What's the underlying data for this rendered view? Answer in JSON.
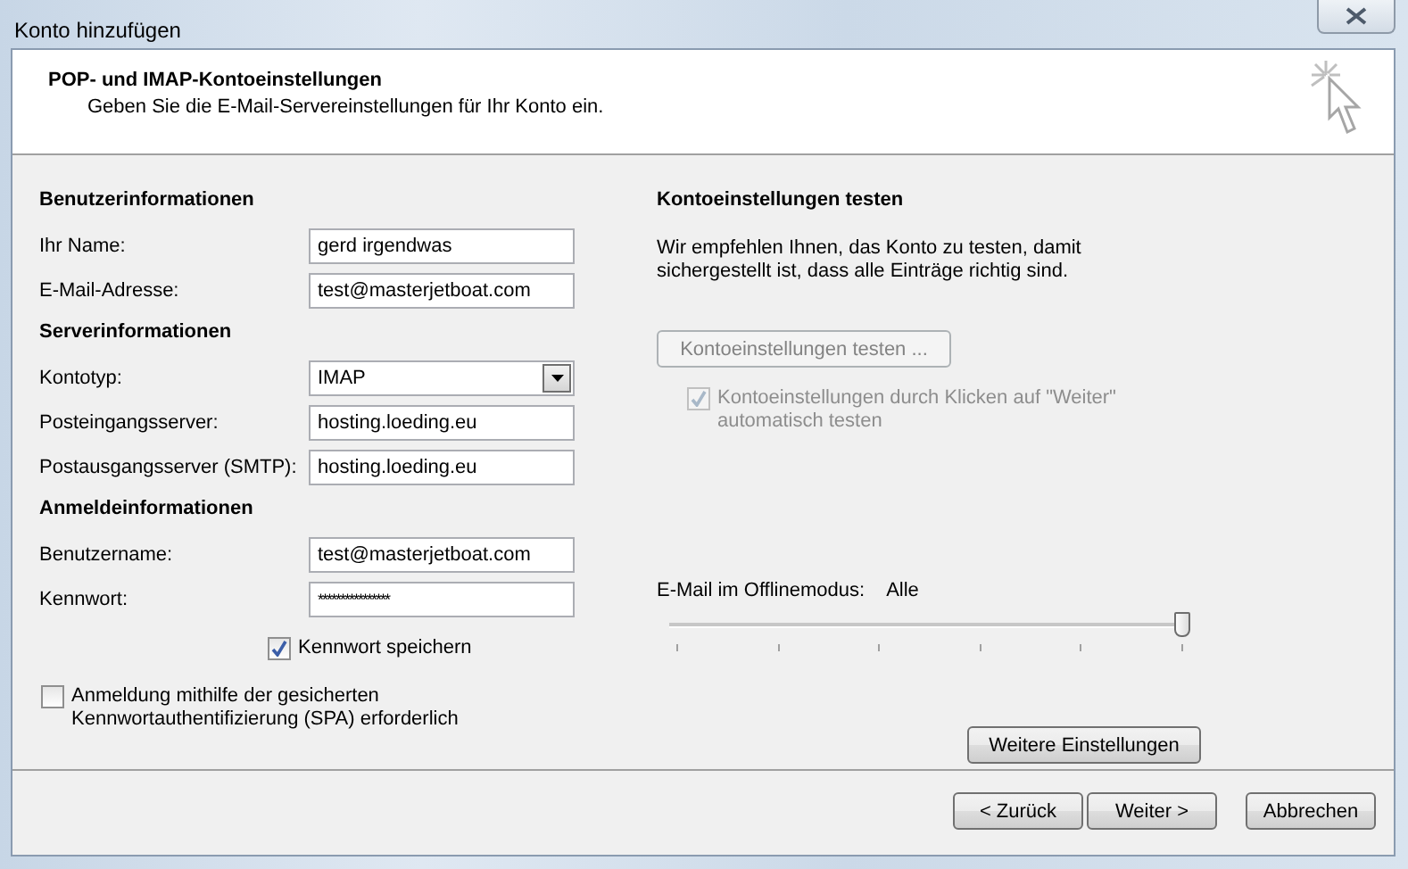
{
  "window": {
    "title": "Konto hinzufügen"
  },
  "header": {
    "title": "POP- und IMAP-Kontoeinstellungen",
    "subtitle": "Geben Sie die E-Mail-Servereinstellungen für Ihr Konto ein."
  },
  "sections": [
    {
      "heading": "Benutzerinformationen",
      "fields": [
        {
          "kind": "text",
          "label": "Ihr Name:",
          "value": "gerd irgendwas"
        },
        {
          "kind": "text",
          "label": "E-Mail-Adresse:",
          "value": "test@masterjetboat.com"
        }
      ]
    },
    {
      "heading": "Serverinformationen",
      "fields": [
        {
          "kind": "dropdown",
          "label": "Kontotyp:",
          "value": "IMAP"
        },
        {
          "kind": "text",
          "label": "Posteingangsserver:",
          "value": "hosting.loeding.eu"
        },
        {
          "kind": "text",
          "label": "Postausgangsserver (SMTP):",
          "value": "hosting.loeding.eu"
        }
      ]
    },
    {
      "heading": "Anmeldeinformationen",
      "fields": [
        {
          "kind": "text",
          "label": "Benutzername:",
          "value": "test@masterjetboat.com"
        },
        {
          "kind": "password",
          "label": "Kennwort:",
          "value": "****************"
        }
      ]
    }
  ],
  "remember_password": {
    "label": "Kennwort speichern",
    "checked": true
  },
  "spa": {
    "label": "Anmeldung mithilfe der gesicherten Kennwortauthentifizierung (SPA) erforderlich",
    "checked": false
  },
  "test": {
    "heading": "Kontoeinstellungen testen",
    "description": "Wir empfehlen Ihnen, das Konto zu testen, damit sichergestellt ist, dass alle Einträge richtig sind.",
    "button": {
      "label": "Kontoeinstellungen testen ...",
      "disabled": true
    },
    "auto_test": {
      "label": "Kontoeinstellungen durch Klicken auf \"Weiter\" automatisch testen",
      "checked": true,
      "disabled": true
    }
  },
  "offline": {
    "label": "E-Mail im Offlinemodus:",
    "value": "Alle",
    "level": 1
  },
  "more_button": {
    "label": "Weitere Einstellungen"
  },
  "footer_buttons": [
    {
      "label": "< Zurück"
    },
    {
      "label": "Weiter >"
    },
    {
      "label": "Abbrechen"
    }
  ]
}
